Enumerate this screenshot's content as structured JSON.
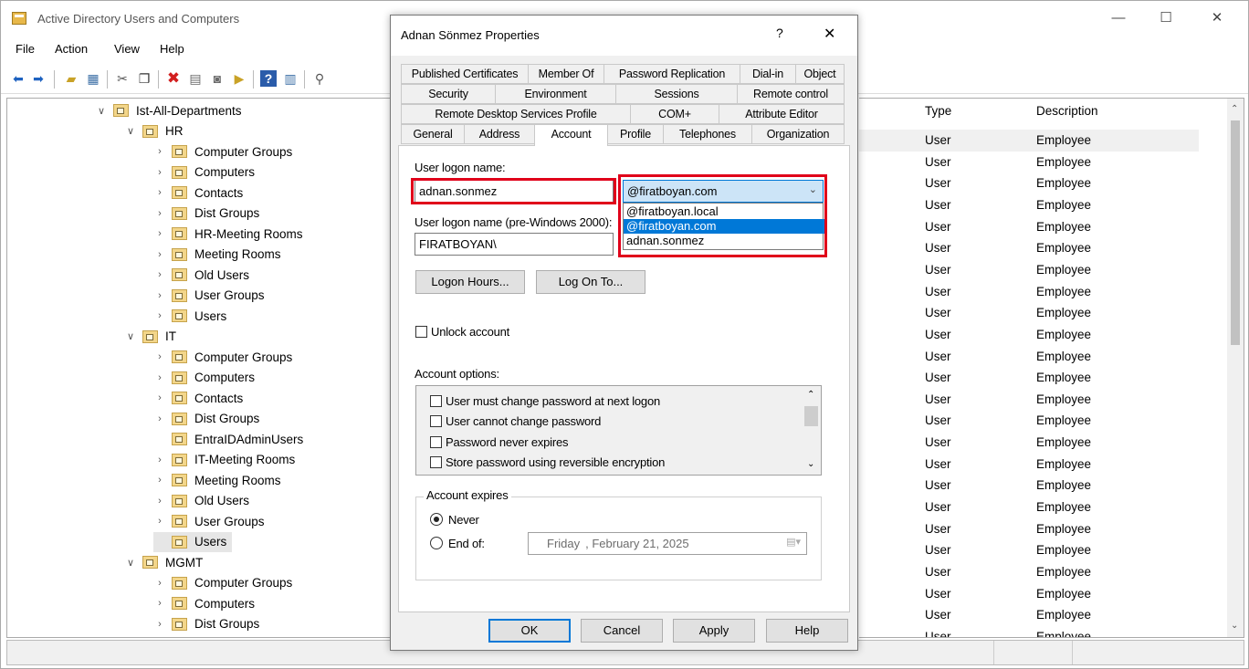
{
  "window": {
    "title": "Active Directory Users and Computers",
    "controls": {
      "minimize": "—",
      "maximize": "☐",
      "close": "✕"
    }
  },
  "menu": [
    "File",
    "Action",
    "View",
    "Help"
  ],
  "tree": {
    "items": [
      {
        "label": "Ist-All-Departments",
        "chev": "v"
      },
      {
        "label": "HR",
        "chev": "v"
      },
      {
        "label": "Computer Groups",
        "chev": ">"
      },
      {
        "label": "Computers",
        "chev": ">"
      },
      {
        "label": "Contacts",
        "chev": ">"
      },
      {
        "label": "Dist Groups",
        "chev": ">"
      },
      {
        "label": "HR-Meeting Rooms",
        "chev": ">"
      },
      {
        "label": "Meeting Rooms",
        "chev": ">"
      },
      {
        "label": "Old Users",
        "chev": ">"
      },
      {
        "label": "User Groups",
        "chev": ">"
      },
      {
        "label": "Users",
        "chev": ">"
      },
      {
        "label": "IT",
        "chev": "v"
      },
      {
        "label": "Computer Groups",
        "chev": ">"
      },
      {
        "label": "Computers",
        "chev": ">"
      },
      {
        "label": "Contacts",
        "chev": ">"
      },
      {
        "label": "Dist Groups",
        "chev": ">"
      },
      {
        "label": "EntraIDAdminUsers",
        "chev": ""
      },
      {
        "label": "IT-Meeting Rooms",
        "chev": ">"
      },
      {
        "label": "Meeting Rooms",
        "chev": ">"
      },
      {
        "label": "Old Users",
        "chev": ">"
      },
      {
        "label": "User Groups",
        "chev": ">"
      },
      {
        "label": "Users",
        "chev": ""
      },
      {
        "label": "MGMT",
        "chev": "v"
      },
      {
        "label": "Computer Groups",
        "chev": ">"
      },
      {
        "label": "Computers",
        "chev": ">"
      },
      {
        "label": "Dist Groups",
        "chev": ">"
      }
    ]
  },
  "list": {
    "columns": [
      "Type",
      "Description"
    ],
    "rows": [
      [
        "User",
        "Employee"
      ],
      [
        "User",
        "Employee"
      ],
      [
        "User",
        "Employee"
      ],
      [
        "User",
        "Employee"
      ],
      [
        "User",
        "Employee"
      ],
      [
        "User",
        "Employee"
      ],
      [
        "User",
        "Employee"
      ],
      [
        "User",
        "Employee"
      ],
      [
        "User",
        "Employee"
      ],
      [
        "User",
        "Employee"
      ],
      [
        "User",
        "Employee"
      ],
      [
        "User",
        "Employee"
      ],
      [
        "User",
        "Employee"
      ],
      [
        "User",
        "Employee"
      ],
      [
        "User",
        "Employee"
      ],
      [
        "User",
        "Employee"
      ],
      [
        "User",
        "Employee"
      ],
      [
        "User",
        "Employee"
      ],
      [
        "User",
        "Employee"
      ],
      [
        "User",
        "Employee"
      ],
      [
        "User",
        "Employee"
      ],
      [
        "User",
        "Employee"
      ],
      [
        "User",
        "Employee"
      ],
      [
        "User",
        "Employee"
      ]
    ],
    "partial_row": [
      "User",
      "Employee"
    ]
  },
  "dialog": {
    "title": "Adnan Sönmez Properties",
    "help": "?",
    "close": "✕",
    "tabs_row1": [
      "Published Certificates",
      "Member Of",
      "Password Replication",
      "Dial-in",
      "Object"
    ],
    "tabs_row2": [
      "Security",
      "Environment",
      "Sessions",
      "Remote control"
    ],
    "tabs_row3": [
      "Remote Desktop Services Profile",
      "COM+",
      "Attribute Editor"
    ],
    "tabs_row4": [
      "General",
      "Address",
      "Account",
      "Profile",
      "Telephones",
      "Organization"
    ],
    "logon_label": "User logon name:",
    "logon_value": "adnan.sonmez",
    "domain_selected": "@firatboyan.com",
    "domain_options": [
      "@firatboyan.local",
      "@firatboyan.com",
      "adnan.sonmez"
    ],
    "pre2000_label": "User logon name (pre-Windows 2000):",
    "pre2000_value": "FIRATBOYAN\\",
    "logon_hours": "Logon Hours...",
    "log_on_to": "Log On To...",
    "unlock": "Unlock account",
    "options_label": "Account options:",
    "options": [
      "User must change password at next logon",
      "User cannot change password",
      "Password never expires",
      "Store password using reversible encryption"
    ],
    "expires_label": "Account expires",
    "never": "Never",
    "end_of": "End of:",
    "date_day": "Friday",
    "date_rest": ", February  21, 2025",
    "ok": "OK",
    "cancel": "Cancel",
    "apply": "Apply",
    "help_btn": "Help"
  }
}
